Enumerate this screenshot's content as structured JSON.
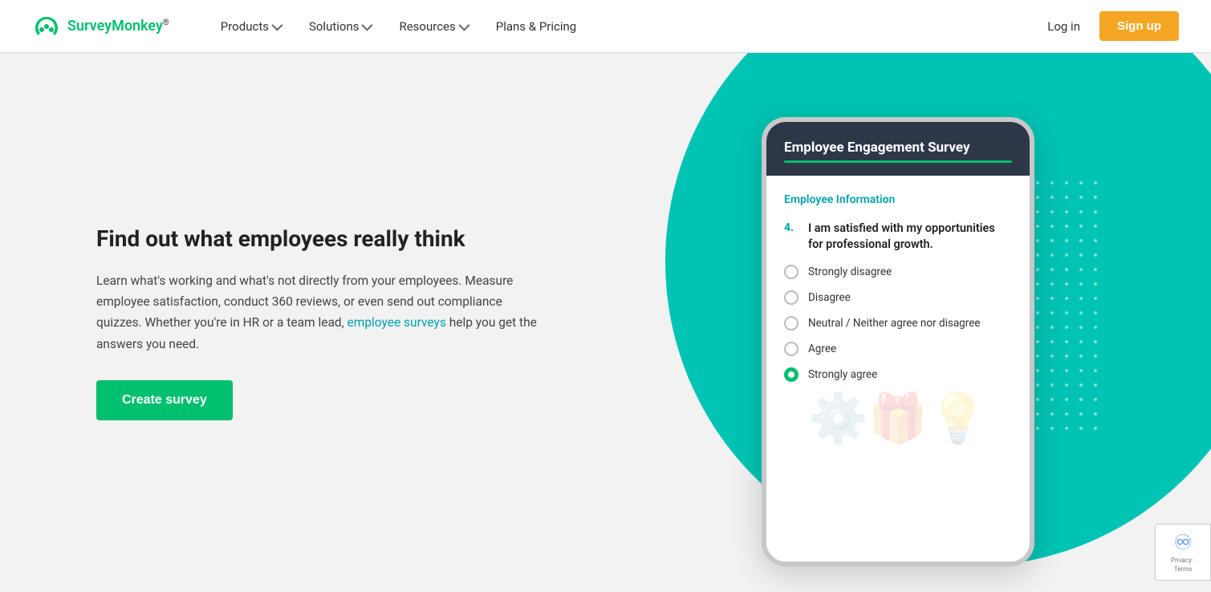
{
  "nav": {
    "logo_text": "SurveyMonkey",
    "logo_trademark": "®",
    "links": [
      {
        "label": "Products",
        "has_chevron": true
      },
      {
        "label": "Solutions",
        "has_chevron": true
      },
      {
        "label": "Resources",
        "has_chevron": true
      },
      {
        "label": "Plans & Pricing",
        "has_chevron": false
      }
    ],
    "login_label": "Log in",
    "signup_label": "Sign up"
  },
  "hero": {
    "title": "Find out what employees really think",
    "body_line1": "Learn what's working and what's not directly from your",
    "body_line2": "employees. Measure employee satisfaction, conduct",
    "body_line3": "360 reviews, or even send out compliance quizzes.",
    "body_line4_prefix": "Whether you're in HR or a team lead, ",
    "body_link": "employee surveys",
    "body_line4_suffix": " help you get the answers you need.",
    "cta_label": "Create survey"
  },
  "phone": {
    "header_title": "Employee Engagement Survey",
    "section_title": "Employee Information",
    "question_number": "4.",
    "question_text": "I am satisfied with my opportunities for professional growth.",
    "options": [
      {
        "label": "Strongly disagree",
        "selected": false
      },
      {
        "label": "Disagree",
        "selected": false
      },
      {
        "label": "Neutral / Neither agree nor disagree",
        "selected": false
      },
      {
        "label": "Agree",
        "selected": false
      },
      {
        "label": "Strongly agree",
        "selected": true
      }
    ]
  },
  "recaptcha": {
    "text": "Privacy · Terms"
  }
}
